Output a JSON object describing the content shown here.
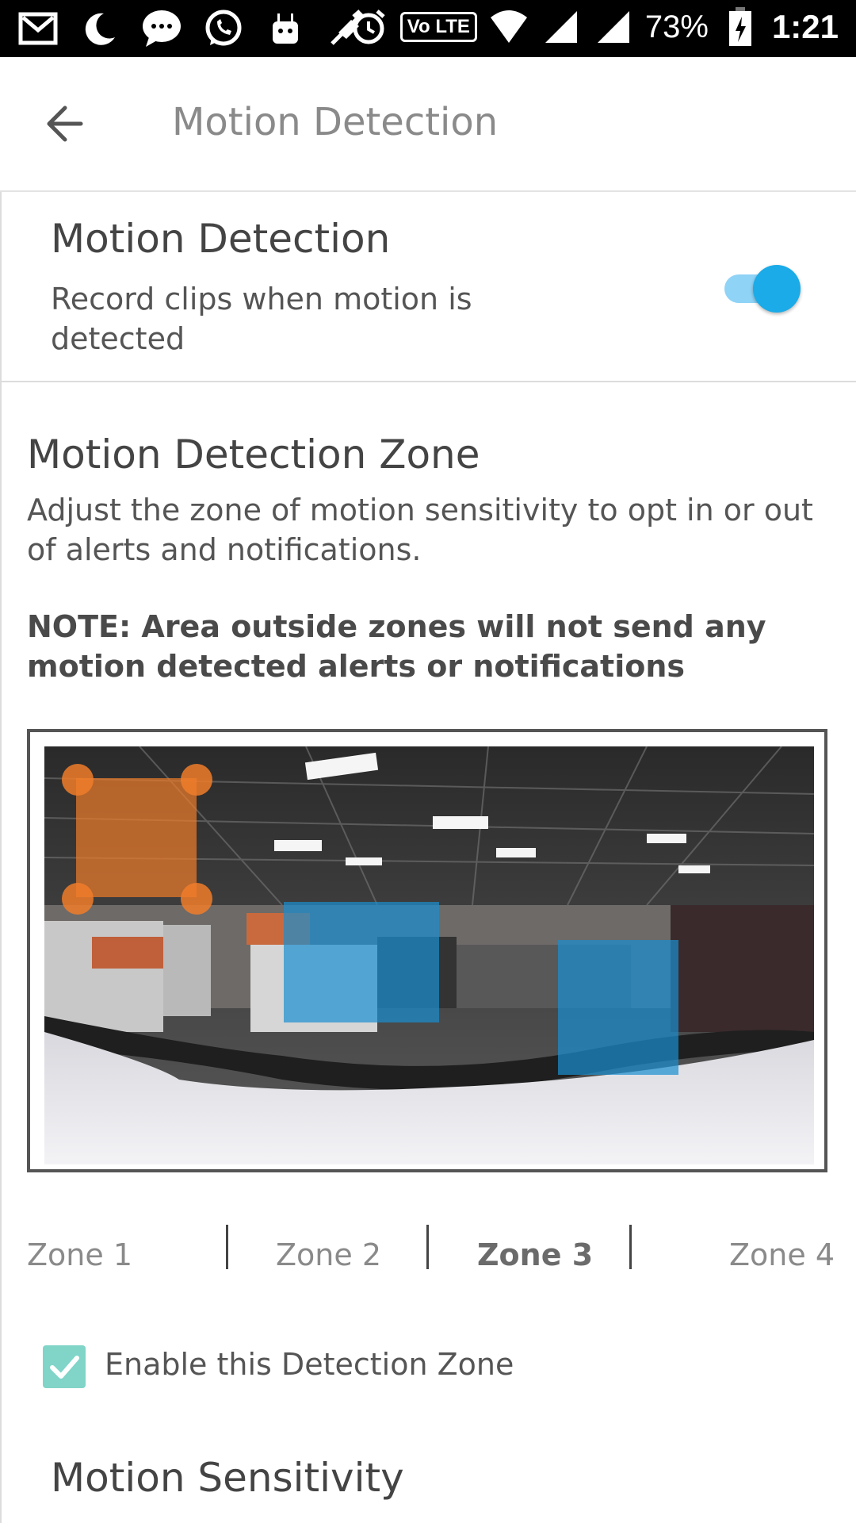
{
  "status_bar": {
    "left_icons": [
      "gmail-icon",
      "moon-icon",
      "messaging-icon",
      "whatsapp-icon",
      "android-icon",
      "mute-icon"
    ],
    "right_icons": [
      "alarm-icon",
      "volte-icon",
      "wifi-icon",
      "signal-icon",
      "signal-icon-2",
      "battery-icon"
    ],
    "volte": "Vo LTE",
    "battery": "73%",
    "time": "1:21"
  },
  "appbar": {
    "title": "Motion Detection"
  },
  "motion_detection": {
    "title": "Motion Detection",
    "subtitle": "Record clips when motion is detected",
    "enabled": true,
    "accent": "#1aabe8"
  },
  "zone": {
    "title": "Motion Detection Zone",
    "description": "Adjust the zone of motion sensitivity to opt in or out of alerts and notifications.",
    "note": "NOTE: Area outside zones will not send any motion detected alerts or notifications",
    "tabs": [
      {
        "label": "Zone 1"
      },
      {
        "label": "Zone 2"
      },
      {
        "label": "Zone 3",
        "active": true
      },
      {
        "label": "Zone 4"
      }
    ],
    "enable_label": "Enable this Detection Zone",
    "enable_checked": true
  },
  "sensitivity": {
    "title": "Motion Sensitivity"
  }
}
